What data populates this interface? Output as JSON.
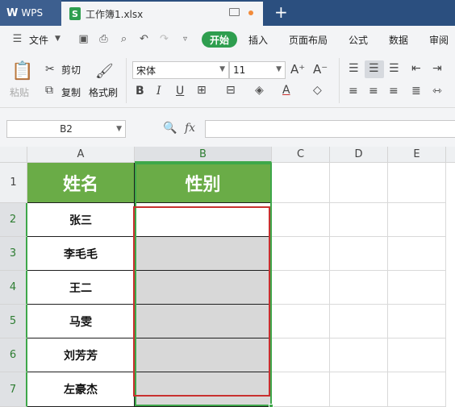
{
  "titlebar": {
    "app_name": "WPS",
    "file_tab": "工作簿1.xlsx",
    "file_icon_letter": "S",
    "new_tab": "+"
  },
  "menubar": {
    "file_menu": "文件",
    "tabs": [
      "开始",
      "插入",
      "页面布局",
      "公式",
      "数据",
      "审阅"
    ]
  },
  "ribbon": {
    "paste": "粘贴",
    "cut": "剪切",
    "copy": "复制",
    "format_painter": "格式刷",
    "font_name": "宋体",
    "font_size": "11"
  },
  "formula_bar": {
    "name_box": "B2",
    "fx": "fx",
    "content": ""
  },
  "sheet": {
    "columns": [
      "A",
      "B",
      "C",
      "D",
      "E"
    ],
    "rows": [
      "1",
      "2",
      "3",
      "4",
      "5",
      "6",
      "7"
    ],
    "header": [
      "姓名",
      "性别"
    ],
    "names": [
      "张三",
      "李毛毛",
      "王二",
      "马雯",
      "刘芳芳",
      "左豪杰"
    ],
    "gender": [
      "",
      "",
      "",
      "",
      "",
      ""
    ],
    "active_cell": "B2"
  },
  "colors": {
    "header_fill": "#6aac47",
    "start_tab": "#2e9e4f",
    "selection": "#3ea74a",
    "annotation": "#c8302f"
  }
}
